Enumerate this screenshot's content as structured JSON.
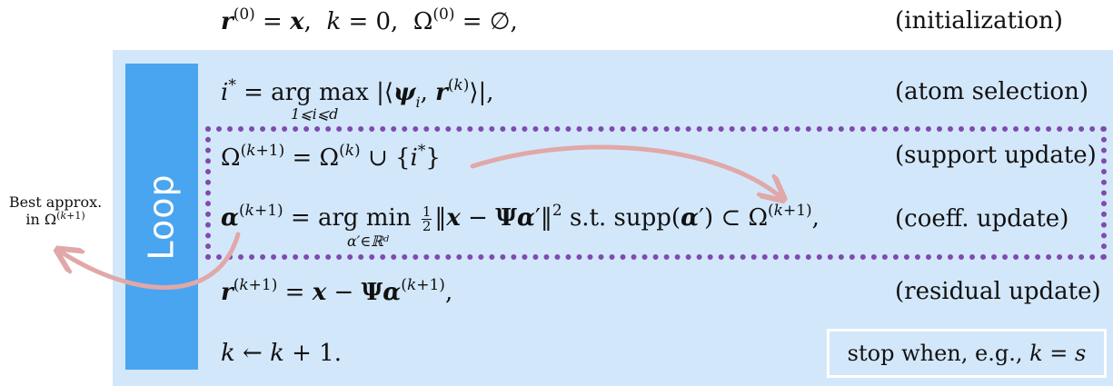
{
  "init": {
    "equation": "r⁽⁰⁾ = x, k = 0, Ω⁽⁰⁾ = ∅,",
    "label": "(initialization)"
  },
  "loop_label": "Loop",
  "steps": [
    {
      "equation": "i* = arg max |⟨ψᵢ, r⁽ᵏ⁾⟩|,",
      "subscript": "1⩽i⩽d",
      "label": "(atom selection)"
    },
    {
      "equation": "Ω⁽ᵏ⁺¹⁾ = Ω⁽ᵏ⁾ ∪ {i*}",
      "label": "(support update)"
    },
    {
      "equation": "α⁽ᵏ⁺¹⁾ = arg min ½‖x − Ψα′‖² s.t. supp(α′) ⊂ Ω⁽ᵏ⁺¹⁾,",
      "subscript": "α′∈ℝᵈ",
      "label": "(coeff. update)"
    },
    {
      "equation": "r⁽ᵏ⁺¹⁾ = x − Ψα⁽ᵏ⁺¹⁾,",
      "label": "(residual update)"
    },
    {
      "equation": "k ← k + 1."
    }
  ],
  "stop_condition": "stop when, e.g., k = s",
  "side_note": {
    "line1": "Best approx.",
    "line2": "in Ω⁽ᵏ⁺¹⁾"
  },
  "colors": {
    "panel": "#d3e7fa",
    "loop_bar": "#4aa5f0",
    "dotted_border": "#7f4bb0",
    "arrow": "#e0a8a8"
  }
}
